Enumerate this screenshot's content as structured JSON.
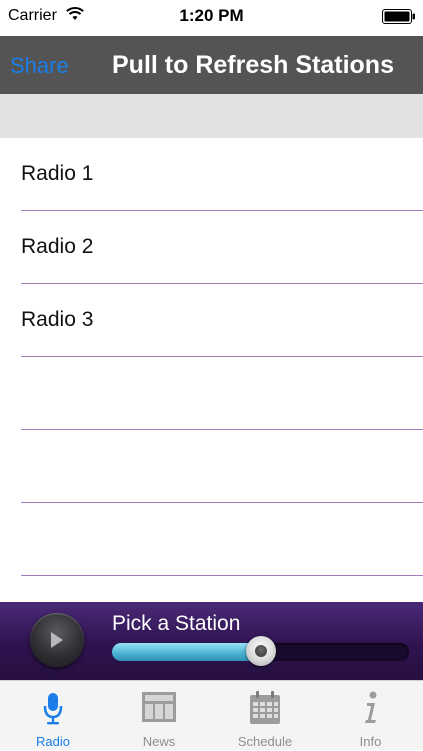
{
  "status_bar": {
    "carrier": "Carrier",
    "time": "1:20 PM",
    "icons": [
      "wifi-icon",
      "battery-icon"
    ]
  },
  "nav_bar": {
    "share_label": "Share",
    "title": "Pull to Refresh Stations"
  },
  "stations": [
    {
      "label": "Radio 1"
    },
    {
      "label": "Radio 2"
    },
    {
      "label": "Radio 3"
    },
    {
      "label": ""
    },
    {
      "label": ""
    },
    {
      "label": ""
    }
  ],
  "player": {
    "title": "Pick a Station",
    "volume_fraction": 0.5,
    "play_icon": "play-icon"
  },
  "tabs": [
    {
      "label": "Radio",
      "icon": "microphone-icon",
      "active": true
    },
    {
      "label": "News",
      "icon": "newspaper-icon",
      "active": false
    },
    {
      "label": "Schedule",
      "icon": "calendar-icon",
      "active": false
    },
    {
      "label": "Info",
      "icon": "info-icon",
      "active": false
    }
  ],
  "colors": {
    "accent": "#1a7dea",
    "nav_background": "#545454",
    "player_background": "#2f1350",
    "separator": "#a47ab8",
    "tab_inactive": "#8e8e8e"
  }
}
